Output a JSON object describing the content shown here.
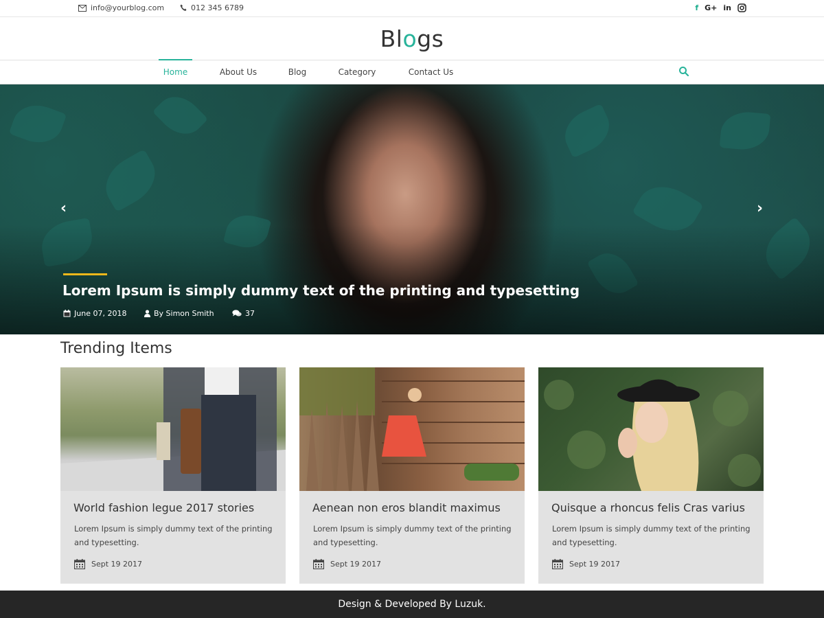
{
  "topbar": {
    "email": "info@yourblog.com",
    "phone": "012 345 6789",
    "social": [
      {
        "name": "facebook-icon",
        "glyph": "f"
      },
      {
        "name": "google-plus-icon",
        "glyph": "G+"
      },
      {
        "name": "linkedin-icon",
        "glyph": "in"
      },
      {
        "name": "instagram-icon",
        "glyph": "◎"
      }
    ]
  },
  "brand": {
    "logo_pre": "Bl",
    "logo_accent": "o",
    "logo_post": "gs",
    "accent_color": "#27b39a"
  },
  "nav": {
    "items": [
      "Home",
      "About Us",
      "Blog",
      "Category",
      "Contact Us"
    ],
    "active": "Home"
  },
  "hero": {
    "title": "Lorem Ipsum is simply dummy text of the printing and typesetting",
    "date": "June 07, 2018",
    "author": "By Simon Smith",
    "comments": "37",
    "prev_icon": "‹",
    "next_icon": "›"
  },
  "trending": {
    "heading": "Trending Items",
    "cards": [
      {
        "title": "World fashion legue 2017 stories",
        "desc": "Lorem Ipsum is simply dummy text of the printing and typesetting.",
        "date": "Sept 19 2017"
      },
      {
        "title": "Aenean non eros blandit maximus",
        "desc": "Lorem Ipsum is simply dummy text of the printing and typesetting.",
        "date": "Sept 19 2017"
      },
      {
        "title": "Quisque a rhoncus felis Cras varius",
        "desc": "Lorem Ipsum is simply dummy text of the printing and typesetting.",
        "date": "Sept 19 2017"
      }
    ]
  },
  "footer": {
    "text": "Design & Developed By Luzuk."
  }
}
